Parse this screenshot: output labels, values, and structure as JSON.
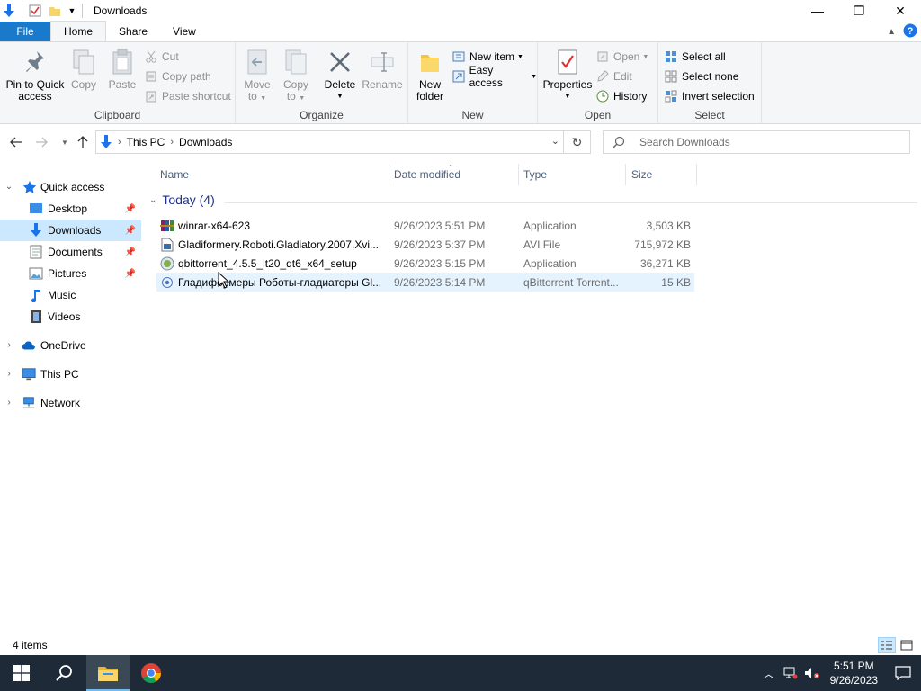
{
  "window": {
    "title": "Downloads",
    "controls": {
      "minimize": "—",
      "maximize": "❐",
      "close": "✕"
    }
  },
  "ribbon_tabs": {
    "file": "File",
    "home": "Home",
    "share": "Share",
    "view": "View"
  },
  "ribbon": {
    "clipboard": {
      "label": "Clipboard",
      "pin": "Pin to Quick access",
      "pin_l1": "Pin to Quick",
      "pin_l2": "access",
      "copy": "Copy",
      "paste": "Paste",
      "cut": "Cut",
      "copy_path": "Copy path",
      "paste_shortcut": "Paste shortcut"
    },
    "organize": {
      "label": "Organize",
      "move_l1": "Move",
      "move_l2": "to",
      "copy_l1": "Copy",
      "copy_l2": "to",
      "delete": "Delete",
      "rename": "Rename"
    },
    "new": {
      "label": "New",
      "folder_l1": "New",
      "folder_l2": "folder",
      "new_item": "New item",
      "easy_access": "Easy access"
    },
    "open": {
      "label": "Open",
      "properties": "Properties",
      "open": "Open",
      "edit": "Edit",
      "history": "History"
    },
    "select": {
      "label": "Select",
      "select_all": "Select all",
      "select_none": "Select none",
      "invert": "Invert selection"
    }
  },
  "address": {
    "crumbs": [
      "This PC",
      "Downloads"
    ],
    "search_placeholder": "Search Downloads"
  },
  "nav": {
    "quick_access": "Quick access",
    "items": [
      {
        "label": "Desktop",
        "pinned": true
      },
      {
        "label": "Downloads",
        "pinned": true,
        "selected": true
      },
      {
        "label": "Documents",
        "pinned": true
      },
      {
        "label": "Pictures",
        "pinned": true
      },
      {
        "label": "Music",
        "pinned": false
      },
      {
        "label": "Videos",
        "pinned": false
      }
    ],
    "onedrive": "OneDrive",
    "this_pc": "This PC",
    "network": "Network"
  },
  "columns": {
    "name": "Name",
    "date": "Date modified",
    "type": "Type",
    "size": "Size"
  },
  "group": {
    "label": "Today (4)"
  },
  "files": [
    {
      "name": "winrar-x64-623",
      "date": "9/26/2023 5:51 PM",
      "type": "Application",
      "size": "3,503 KB",
      "icon": "winrar-icon"
    },
    {
      "name": "Gladiformery.Roboti.Gladiatory.2007.Xvi...",
      "date": "9/26/2023 5:37 PM",
      "type": "AVI File",
      "size": "715,972 KB",
      "icon": "video-file-icon"
    },
    {
      "name": "qbittorrent_4.5.5_lt20_qt6_x64_setup",
      "date": "9/26/2023 5:15 PM",
      "type": "Application",
      "size": "36,271 KB",
      "icon": "qbittorrent-setup-icon"
    },
    {
      "name": "Гладиформеры Роботы-гладиаторы Gl...",
      "date": "9/26/2023 5:14 PM",
      "type": "qBittorrent Torrent...",
      "size": "15 KB",
      "icon": "torrent-file-icon"
    }
  ],
  "status": {
    "count": "4 items"
  },
  "taskbar": {
    "time": "5:51 PM",
    "date": "9/26/2023"
  },
  "colors": {
    "accent": "#1979ca",
    "selected": "#cce8ff",
    "hover": "#e5f3ff",
    "taskbar": "#1e2a38",
    "group_header": "#1e3287"
  }
}
